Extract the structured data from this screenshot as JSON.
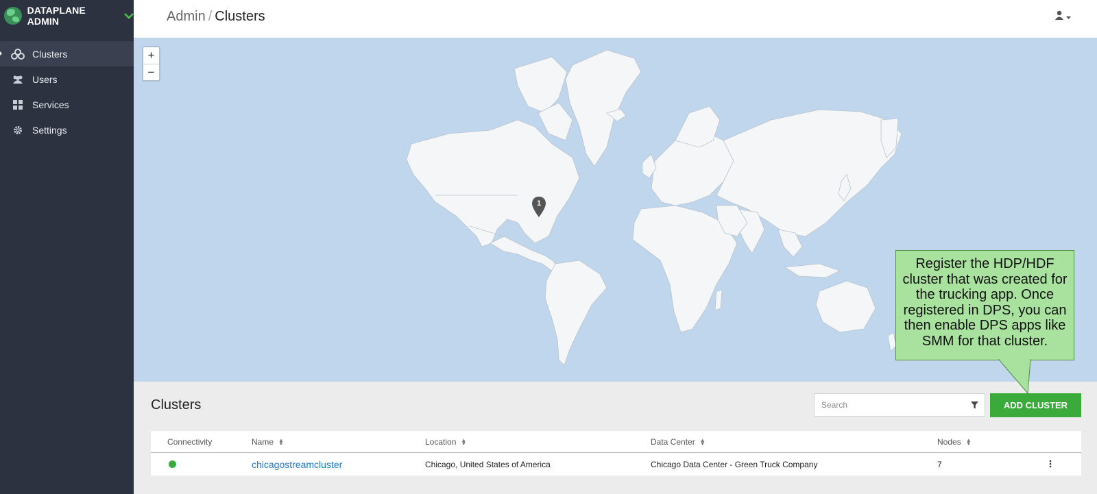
{
  "app": {
    "brand": "DATAPLANE ADMIN"
  },
  "sidebar": {
    "items": [
      {
        "label": "Clusters",
        "icon": "clusters-icon",
        "active": true
      },
      {
        "label": "Users",
        "icon": "users-icon",
        "active": false
      },
      {
        "label": "Services",
        "icon": "grid-icon",
        "active": false
      },
      {
        "label": "Settings",
        "icon": "gear-icon",
        "active": false
      }
    ]
  },
  "header": {
    "breadcrumb_root": "Admin",
    "breadcrumb_separator": "/",
    "breadcrumb_current": "Clusters",
    "user_icon": "user-icon"
  },
  "map": {
    "zoom_in": "+",
    "zoom_out": "−",
    "marker_count": "1"
  },
  "callout": {
    "text": "Register the HDP/HDF cluster that was created for the trucking app. Once registered in DPS, you can then enable DPS apps like SMM for that cluster."
  },
  "clusters": {
    "title": "Clusters",
    "search_placeholder": "Search",
    "add_button": "ADD CLUSTER",
    "columns": [
      "Connectivity",
      "Name",
      "Location",
      "Data Center",
      "Nodes"
    ],
    "rows": [
      {
        "connectivity": "online",
        "name": "chicagostreamcluster",
        "location": "Chicago, United States of America",
        "data_center": "Chicago Data Center - Green Truck Company",
        "nodes": "7"
      }
    ]
  },
  "colors": {
    "sidebar_bg": "#2d3240",
    "accent_green": "#3aab3a",
    "map_water": "#c0d6ec",
    "land": "#f4f6f8",
    "link": "#1f78c6",
    "callout_bg": "#a8e29e"
  }
}
